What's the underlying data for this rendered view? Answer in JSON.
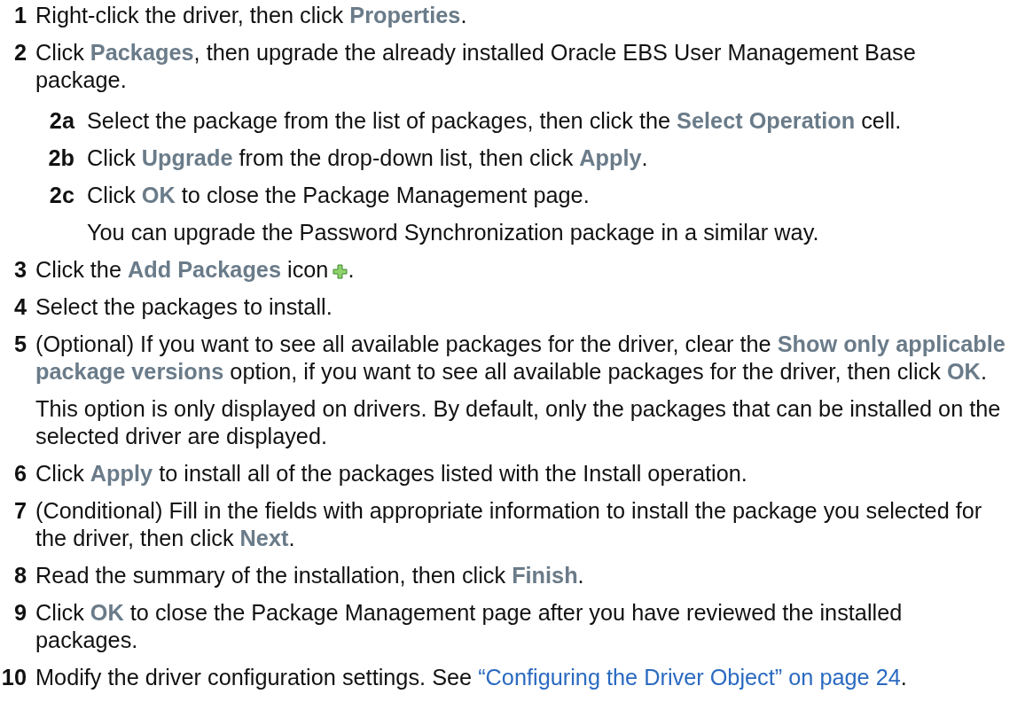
{
  "steps": [
    {
      "number": "1",
      "text": "Right-click the driver, then click **Properties**."
    },
    {
      "number": "2",
      "text": "Click **Packages**, then upgrade the already installed Oracle EBS User Management Base package.",
      "substeps": [
        {
          "number": "2a",
          "text": "Select the package from the list of packages, then click the **Select Operation** cell."
        },
        {
          "number": "2b",
          "text": "Click **Upgrade** from the drop-down list, then click **Apply**."
        },
        {
          "number": "2c",
          "text": "Click **OK** to close the Package Management page.",
          "notes": [
            "You can upgrade the Password Synchronization package in a similar way."
          ]
        }
      ]
    },
    {
      "number": "3",
      "text": "Click the **Add Packages** icon",
      "kind": "icon",
      "text_after": "."
    },
    {
      "number": "4",
      "text": "Select the packages to install."
    },
    {
      "number": "5",
      "text": "(Optional) If you want to see all available packages for the driver, clear the **Show only applicable package versions** option, if you want to see all available packages for the driver, then click **OK**.",
      "notes": [
        "This option is only displayed on drivers. By default, only the packages that can be installed on the selected driver are displayed."
      ]
    },
    {
      "number": "6",
      "text": "Click **Apply** to install all of the packages listed with the Install operation."
    },
    {
      "number": "7",
      "text": "(Conditional) Fill in the fields with appropriate information to install the package you selected for the driver, then click **Next**."
    },
    {
      "number": "8",
      "text": "Read the summary of the installation, then click **Finish**."
    },
    {
      "number": "9",
      "text": "Click **OK** to close the Package Management page after you have reviewed the installed packages."
    },
    {
      "number": "10",
      "text": "Modify the driver configuration settings. See",
      "link": "“Configuring the Driver Object” on page 24",
      "text_after": "."
    }
  ]
}
